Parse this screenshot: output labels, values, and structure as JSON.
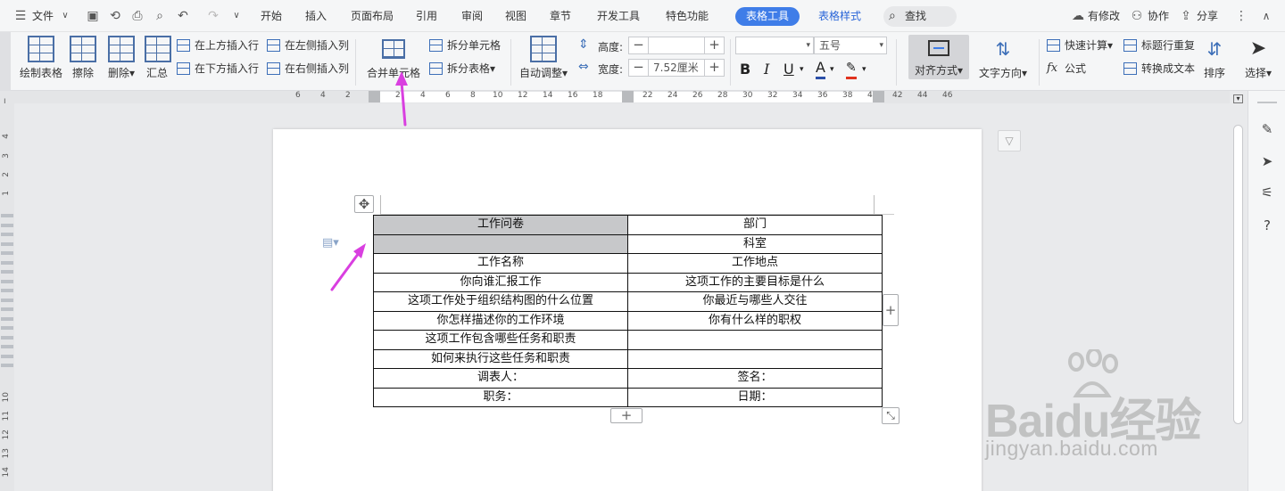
{
  "menubar": {
    "file": "文件",
    "tabs": [
      "开始",
      "插入",
      "页面布局",
      "引用",
      "审阅",
      "视图",
      "章节",
      "开发工具",
      "特色功能"
    ],
    "active_tab": "表格工具",
    "extra_tab": "表格样式",
    "search": "查找",
    "has_changes": "有修改",
    "collaborate": "协作",
    "share": "分享"
  },
  "ribbon": {
    "draw_table": "绘制表格",
    "erase": "擦除",
    "delete": "删除",
    "summary": "汇总",
    "insert_above": "在上方插入行",
    "insert_below": "在下方插入行",
    "insert_left": "在左侧插入列",
    "insert_right": "在右侧插入列",
    "merge_cells": "合并单元格",
    "split_cells": "拆分单元格",
    "split_table": "拆分表格",
    "auto_adjust": "自动调整",
    "height_label": "高度:",
    "height_value": "",
    "width_label": "宽度:",
    "width_value": "7.52厘米",
    "font_name": "",
    "font_size": "五号",
    "bold": "B",
    "italic": "I",
    "underline": "U",
    "font_color": "A",
    "align": "对齐方式",
    "text_direction": "文字方向",
    "quick_calc": "快速计算",
    "repeat_header": "标题行重复",
    "formula": "公式",
    "to_text": "转换成文本",
    "sort": "排序",
    "select": "选择"
  },
  "hruler": {
    "left_ticks": [
      "6",
      "4",
      "2"
    ],
    "mid_ticks": [
      "2",
      "4",
      "6",
      "8",
      "10",
      "12",
      "14",
      "16",
      "18"
    ],
    "right_ticks": [
      "22",
      "24",
      "26",
      "28",
      "30",
      "32",
      "34",
      "36",
      "38",
      "4"
    ],
    "tail_ticks": [
      "42",
      "44",
      "46"
    ]
  },
  "vruler": {
    "top_ticks": [
      "4",
      "3",
      "2",
      "1"
    ],
    "bottom_ticks": [
      "10",
      "11",
      "12",
      "13",
      "14"
    ]
  },
  "table": {
    "rows": [
      [
        "工作问卷",
        "部门"
      ],
      [
        "",
        "科室"
      ],
      [
        "工作名称",
        "工作地点"
      ],
      [
        "你向谁汇报工作",
        "这项工作的主要目标是什么"
      ],
      [
        "这项工作处于组织结构图的什么位置",
        "你最近与哪些人交往"
      ],
      [
        "你怎样描述你的工作环境",
        "你有什么样的职权"
      ],
      [
        "这项工作包含哪些任务和职责",
        ""
      ],
      [
        "如何来执行这些任务和职责",
        ""
      ],
      [
        "调表人：",
        "签名："
      ],
      [
        "职务：",
        "日期："
      ]
    ],
    "shaded_cells": [
      [
        0,
        0
      ],
      [
        1,
        0
      ]
    ]
  },
  "watermark": {
    "brand": "Baidu经验",
    "url": "jingyan.baidu.com"
  },
  "colors": {
    "accent": "#3f7de8",
    "arrow": "#d93fe0",
    "shade": "#c7c8ca"
  }
}
